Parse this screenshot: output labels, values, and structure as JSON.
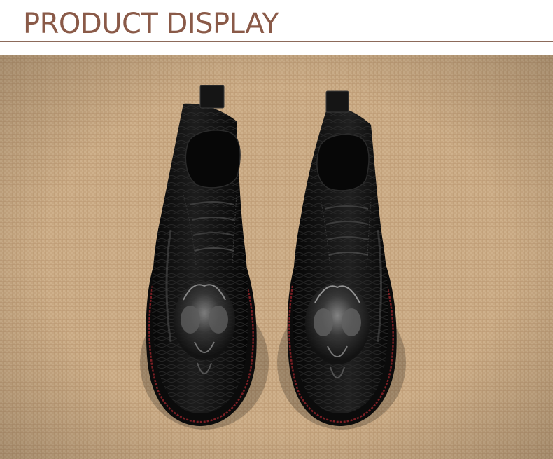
{
  "header": {
    "title": "PRODUCT DISPLAY",
    "title_color": "#8a5a48",
    "rule_color": "#8c6a5a"
  },
  "photo": {
    "subject": "pair-of-black-crocodile-embossed-leather-ankle-boots",
    "background": "burlap-fabric",
    "colors": {
      "fabric": "#c9a983",
      "leather": "#101010",
      "welt_stitch": "#7a1f24"
    }
  }
}
